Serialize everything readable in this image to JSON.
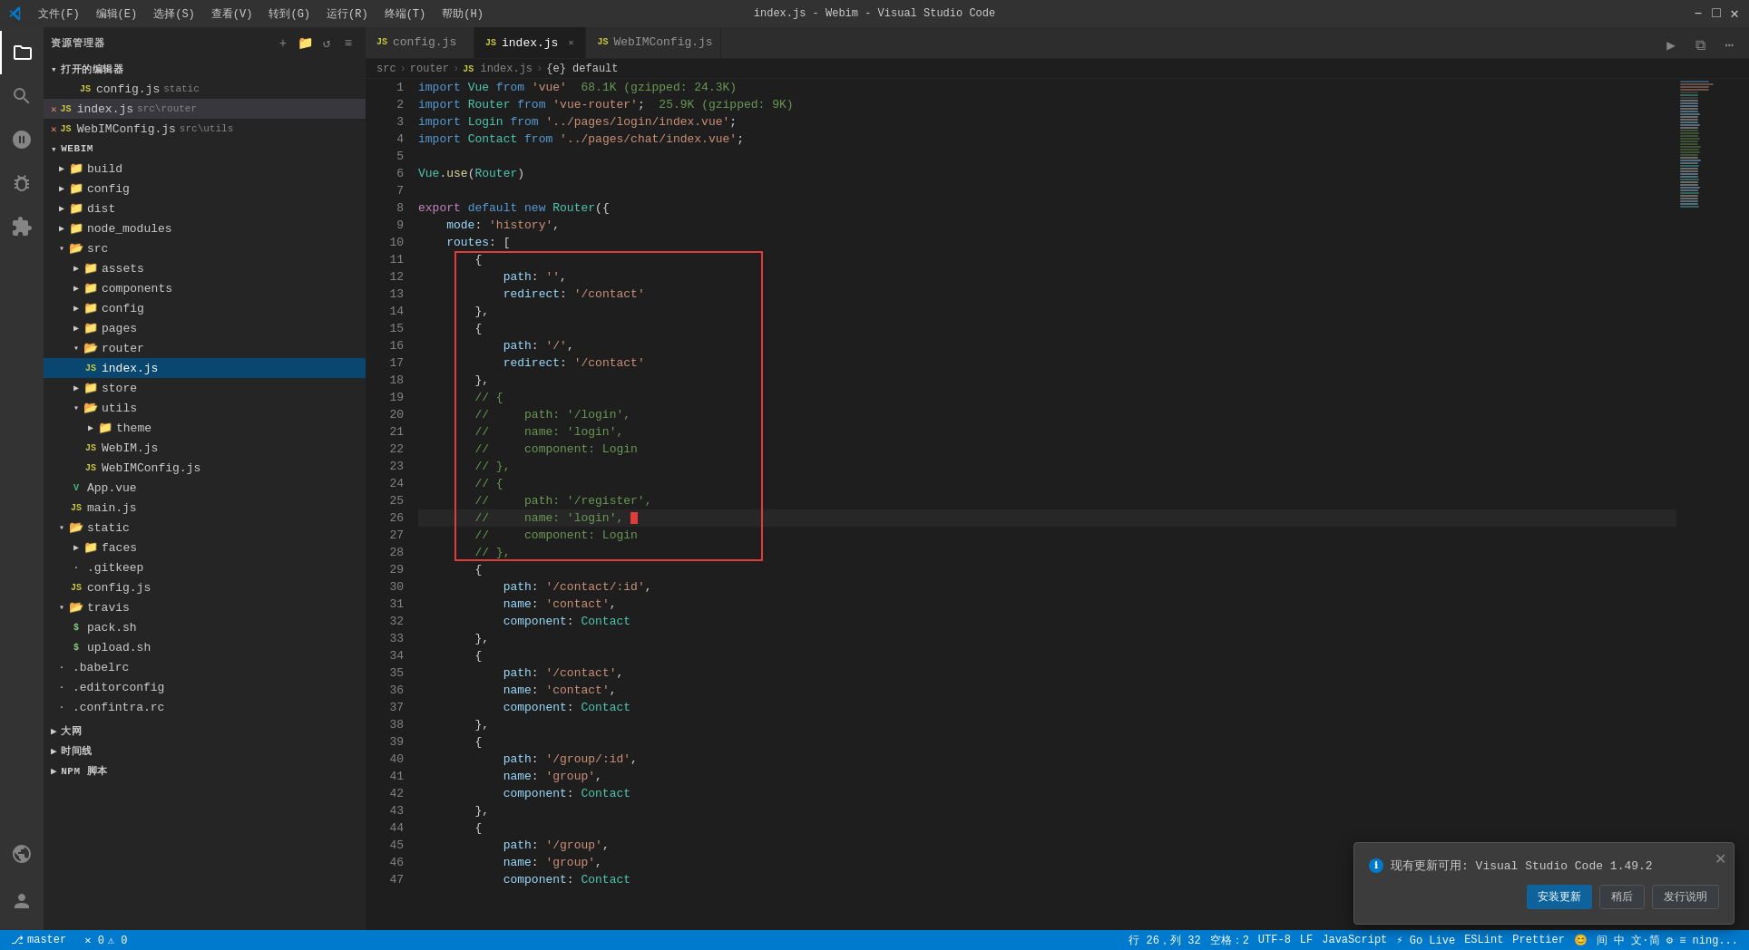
{
  "window": {
    "title": "index.js - Webim - Visual Studio Code"
  },
  "titlebar": {
    "menus": [
      "文件(F)",
      "编辑(E)",
      "选择(S)",
      "查看(V)",
      "转到(G)",
      "运行(R)",
      "终端(T)",
      "帮助(H)"
    ]
  },
  "tabs": [
    {
      "id": "config-js",
      "label": "config.js",
      "icon": "JS",
      "active": false,
      "modified": false
    },
    {
      "id": "index-js",
      "label": "index.js",
      "icon": "JS",
      "active": true,
      "modified": false
    },
    {
      "id": "webimconfig-js",
      "label": "WebIMConfig.js",
      "icon": "JS",
      "active": false,
      "modified": false
    }
  ],
  "breadcrumb": [
    "src",
    ">",
    "router",
    ">",
    "JS index.js",
    ">",
    "{e} default"
  ],
  "sidebar": {
    "title": "资源管理器",
    "section": "打开的编辑器",
    "open_files": [
      {
        "name": "config.js",
        "desc": "static",
        "type": "js",
        "error": false
      },
      {
        "name": "index.js",
        "desc": "src\\router",
        "type": "js",
        "error": false,
        "active": true
      },
      {
        "name": "WebIMConfig.js",
        "desc": "src\\utils",
        "type": "js",
        "error": false
      }
    ],
    "project": "WEBIM",
    "tree": [
      {
        "level": 0,
        "type": "folder",
        "label": "build",
        "open": false
      },
      {
        "level": 0,
        "type": "folder",
        "label": "config",
        "open": false
      },
      {
        "level": 0,
        "type": "folder",
        "label": "dist",
        "open": false
      },
      {
        "level": 0,
        "type": "folder",
        "label": "node_modules",
        "open": false
      },
      {
        "level": 0,
        "type": "folder",
        "label": "src",
        "open": true
      },
      {
        "level": 1,
        "type": "folder",
        "label": "assets",
        "open": false
      },
      {
        "level": 1,
        "type": "folder",
        "label": "components",
        "open": false
      },
      {
        "level": 1,
        "type": "folder",
        "label": "config",
        "open": false
      },
      {
        "level": 1,
        "type": "folder",
        "label": "pages",
        "open": false
      },
      {
        "level": 1,
        "type": "folder",
        "label": "router",
        "open": true
      },
      {
        "level": 2,
        "type": "file-js",
        "label": "index.js",
        "active": true
      },
      {
        "level": 1,
        "type": "folder",
        "label": "store",
        "open": false
      },
      {
        "level": 1,
        "type": "folder",
        "label": "utils",
        "open": true
      },
      {
        "level": 2,
        "type": "folder",
        "label": "theme",
        "open": false
      },
      {
        "level": 2,
        "type": "file-js",
        "label": "WebIM.js"
      },
      {
        "level": 2,
        "type": "file-js",
        "label": "WebIMConfig.js"
      },
      {
        "level": 1,
        "type": "file-vue",
        "label": "App.vue"
      },
      {
        "level": 1,
        "type": "file-js",
        "label": "main.js"
      },
      {
        "level": 0,
        "type": "folder",
        "label": "static",
        "open": true
      },
      {
        "level": 1,
        "type": "folder",
        "label": "faces",
        "open": false
      },
      {
        "level": 1,
        "type": "file-generic",
        "label": ".gitkeep"
      },
      {
        "level": 0,
        "type": "file-generic",
        "label": "config.js"
      },
      {
        "level": 0,
        "type": "folder",
        "label": "travis",
        "open": true
      },
      {
        "level": 1,
        "type": "file-sh",
        "label": "pack.sh"
      },
      {
        "level": 1,
        "type": "file-sh",
        "label": "upload.sh"
      },
      {
        "level": 0,
        "type": "file-generic",
        "label": ".babelrc"
      },
      {
        "level": 0,
        "type": "file-generic",
        "label": ".editorconfig"
      },
      {
        "level": 0,
        "type": "file-generic",
        "label": ".confintra.rc"
      }
    ],
    "bottom_items": [
      {
        "label": "大网"
      },
      {
        "label": "时间线"
      },
      {
        "label": "NPM 脚本"
      }
    ]
  },
  "code": {
    "lines": [
      {
        "n": 1,
        "text": "import Vue from 'vue'  68.1K (gzipped: 24.3K)"
      },
      {
        "n": 2,
        "text": "import Router from 'vue-router';  25.9K (gzipped: 9K)"
      },
      {
        "n": 3,
        "text": "import Login from '../pages/login/index.vue';"
      },
      {
        "n": 4,
        "text": "import Contact from '../pages/chat/index.vue';"
      },
      {
        "n": 5,
        "text": ""
      },
      {
        "n": 6,
        "text": "Vue.use(Router)"
      },
      {
        "n": 7,
        "text": ""
      },
      {
        "n": 8,
        "text": "export default new Router({"
      },
      {
        "n": 9,
        "text": "    mode: 'history',"
      },
      {
        "n": 10,
        "text": "    routes: ["
      },
      {
        "n": 11,
        "text": "        {"
      },
      {
        "n": 12,
        "text": "            path: '',"
      },
      {
        "n": 13,
        "text": "            redirect: '/contact'"
      },
      {
        "n": 14,
        "text": "        },"
      },
      {
        "n": 15,
        "text": "        {"
      },
      {
        "n": 16,
        "text": "            path: '/',"
      },
      {
        "n": 17,
        "text": "            redirect: '/contact'"
      },
      {
        "n": 18,
        "text": "        },"
      },
      {
        "n": 19,
        "text": "        // {"
      },
      {
        "n": 20,
        "text": "        //     path: '/login',"
      },
      {
        "n": 21,
        "text": "        //     name: 'login',"
      },
      {
        "n": 22,
        "text": "        //     component: Login"
      },
      {
        "n": 23,
        "text": "        // },"
      },
      {
        "n": 24,
        "text": "        // {"
      },
      {
        "n": 25,
        "text": "        //     path: '/register',"
      },
      {
        "n": 26,
        "text": "        //     name: 'login', "
      },
      {
        "n": 27,
        "text": "        //     component: Login"
      },
      {
        "n": 28,
        "text": "        // },"
      },
      {
        "n": 29,
        "text": "        {"
      },
      {
        "n": 30,
        "text": "            path: '/contact/:id',"
      },
      {
        "n": 31,
        "text": "            name: 'contact',"
      },
      {
        "n": 32,
        "text": "            component: Contact"
      },
      {
        "n": 33,
        "text": "        },"
      },
      {
        "n": 34,
        "text": "        {"
      },
      {
        "n": 35,
        "text": "            path: '/contact',"
      },
      {
        "n": 36,
        "text": "            name: 'contact',"
      },
      {
        "n": 37,
        "text": "            component: Contact"
      },
      {
        "n": 38,
        "text": "        },"
      },
      {
        "n": 39,
        "text": "        {"
      },
      {
        "n": 40,
        "text": "            path: '/group/:id',"
      },
      {
        "n": 41,
        "text": "            name: 'group',"
      },
      {
        "n": 42,
        "text": "            component: Contact"
      },
      {
        "n": 43,
        "text": "        },"
      },
      {
        "n": 44,
        "text": "        {"
      },
      {
        "n": 45,
        "text": "            path: '/group',"
      },
      {
        "n": 46,
        "text": "            name: 'group',"
      },
      {
        "n": 47,
        "text": "            component: Contact"
      }
    ]
  },
  "statusbar": {
    "git": "行 26，列 32",
    "errors": "空格：2",
    "encoding": "UTF-8",
    "eol": "LF",
    "language": "JavaScript",
    "go_live": "⚡ Go Live",
    "eslint": "ESLint",
    "prettier": "Prettier",
    "feedback": "😊"
  },
  "notification": {
    "message": "现有更新可用: Visual Studio Code 1.49.2",
    "btn_update": "安装更新",
    "btn_later": "稍后",
    "btn_release": "发行说明"
  },
  "input_bar": {
    "content": "间 中  文·简 ⚙ ≡ ning..."
  }
}
